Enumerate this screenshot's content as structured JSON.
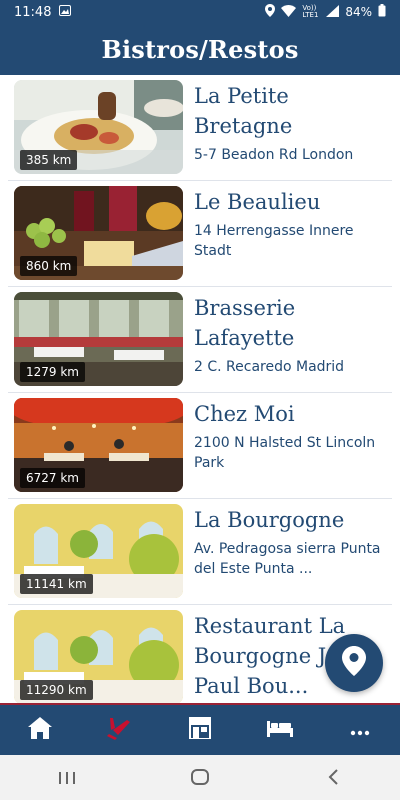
{
  "status_bar": {
    "time": "11:48",
    "network": "Vo)) LTE1",
    "battery": "84%"
  },
  "header": {
    "title": "Bistros/Restos"
  },
  "restaurants": [
    {
      "name": "La Petite Bretagne",
      "address": "5-7 Beadon Rd London",
      "distance": "385 km",
      "image": "pasta-plate"
    },
    {
      "name": "Le Beaulieu",
      "address": "14 Herrengasse Innere Stadt",
      "distance": "860 km",
      "image": "cheese-wine"
    },
    {
      "name": "Brasserie Lafayette",
      "address": "2 C. Recaredo Madrid",
      "distance": "1279 km",
      "image": "dining-room-green"
    },
    {
      "name": "Chez Moi",
      "address": "2100 N Halsted St Lincoln Park",
      "distance": "6727 km",
      "image": "dining-room-red"
    },
    {
      "name": "La Bourgogne",
      "address": "Av. Pedragosa sierra Punta del Este Punta ...",
      "distance": "11141 km",
      "image": "yellow-room-flowers"
    },
    {
      "name": "Restaurant La Bourgogne Jean-Paul Bou...",
      "address": "",
      "distance": "11290 km",
      "image": "yellow-room-flowers"
    }
  ],
  "tabs": [
    {
      "icon": "home-icon",
      "active": false
    },
    {
      "icon": "fork-knife-icon",
      "active": true
    },
    {
      "icon": "store-icon",
      "active": false
    },
    {
      "icon": "bed-icon",
      "active": false
    },
    {
      "icon": "more-icon",
      "active": false
    }
  ],
  "colors": {
    "primary": "#234a73",
    "accent": "#c8102e",
    "text": "#234a73"
  }
}
